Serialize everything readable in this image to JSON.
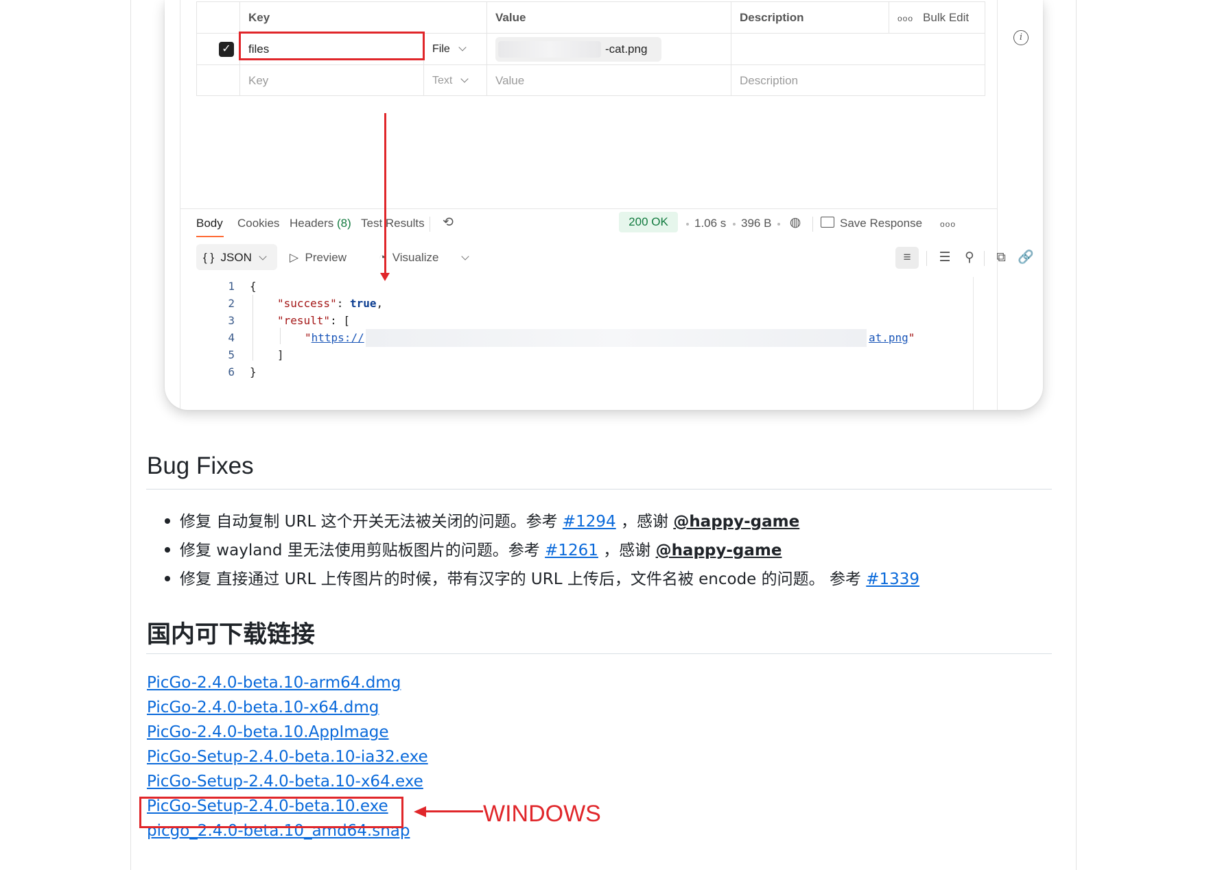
{
  "params_table": {
    "headers": {
      "key": "Key",
      "value": "Value",
      "description": "Description",
      "bulk_edit": "Bulk Edit"
    },
    "rows": [
      {
        "checked": true,
        "key": "files",
        "type": "File",
        "value": "-cat.png",
        "description": ""
      }
    ],
    "placeholder_row": {
      "key": "Key",
      "type": "Text",
      "value": "Value",
      "description": "Description"
    }
  },
  "response": {
    "tabs": [
      "Body",
      "Cookies",
      "Headers",
      "Test Results"
    ],
    "headers_count": "(8)",
    "status": "200 OK",
    "time": "1.06 s",
    "size": "396 B",
    "save_response": "Save Response",
    "format": "JSON",
    "preview": "Preview",
    "visualize": "Visualize",
    "code_lines": [
      "1",
      "2",
      "3",
      "4",
      "5",
      "6"
    ],
    "json": {
      "open": "{",
      "success_key": "\"success\"",
      "success_val": "true",
      "result_key": "\"result\"",
      "url_start": "https://",
      "url_end": "at.png",
      "close_arr": "]",
      "close": "}"
    }
  },
  "article": {
    "bug_fixes_title": "Bug Fixes",
    "bugs": [
      {
        "text": "修复 自动复制 URL 这个开关无法被关闭的问题。参考 ",
        "issue": "#1294",
        "thanks": " ，感谢 ",
        "user": "@happy-game"
      },
      {
        "text": "修复 wayland 里无法使用剪贴板图片的问题。参考 ",
        "issue": "#1261",
        "thanks": " ，感谢 ",
        "user": "@happy-game"
      },
      {
        "text": "修复 直接通过 URL 上传图片的时候，带有汉字的 URL 上传后，文件名被 encode 的问题。 参考 ",
        "issue": "#1339",
        "thanks": "",
        "user": ""
      }
    ],
    "downloads_title": "国内可下载链接",
    "downloads": [
      "PicGo-2.4.0-beta.10-arm64.dmg",
      "PicGo-2.4.0-beta.10-x64.dmg",
      "PicGo-2.4.0-beta.10.AppImage",
      "PicGo-Setup-2.4.0-beta.10-ia32.exe",
      "PicGo-Setup-2.4.0-beta.10-x64.exe",
      "PicGo-Setup-2.4.0-beta.10.exe",
      "picgo_2.4.0-beta.10_amd64.snap"
    ],
    "annotation": "WINDOWS"
  },
  "colors": {
    "annotation_red": "#e0262a",
    "link_blue": "#0969da",
    "status_green": "#117a3e",
    "accent_orange": "#ff6c37"
  }
}
